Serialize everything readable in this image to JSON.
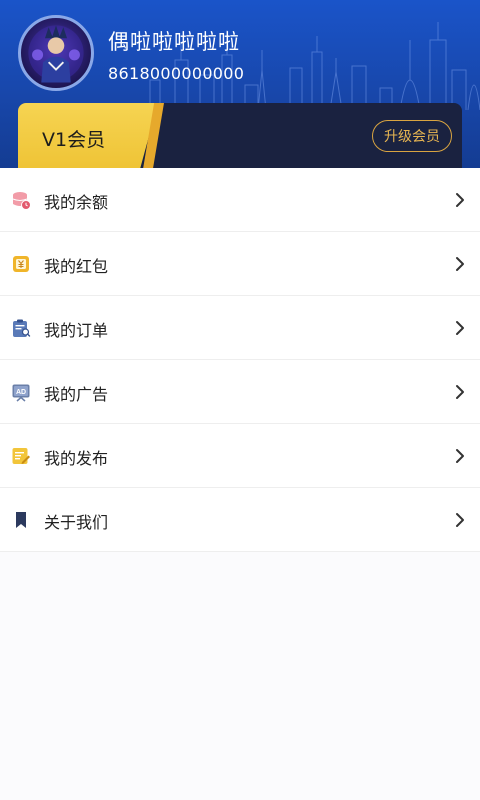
{
  "profile": {
    "username": "偶啦啦啦啦啦",
    "phone": "8618000000000"
  },
  "membership": {
    "level_label": "V1会员",
    "upgrade_label": "升级会员"
  },
  "menu": {
    "items": [
      {
        "label": "我的余额",
        "icon": "balance-icon"
      },
      {
        "label": "我的红包",
        "icon": "red-packet-icon"
      },
      {
        "label": "我的订单",
        "icon": "order-icon"
      },
      {
        "label": "我的广告",
        "icon": "ad-icon"
      },
      {
        "label": "我的发布",
        "icon": "publish-icon"
      },
      {
        "label": "关于我们",
        "icon": "bookmark-icon"
      }
    ]
  },
  "colors": {
    "header_blue": "#1a54c9",
    "vip_gold": "#f0c63a",
    "upgrade_accent": "#e7b552"
  }
}
